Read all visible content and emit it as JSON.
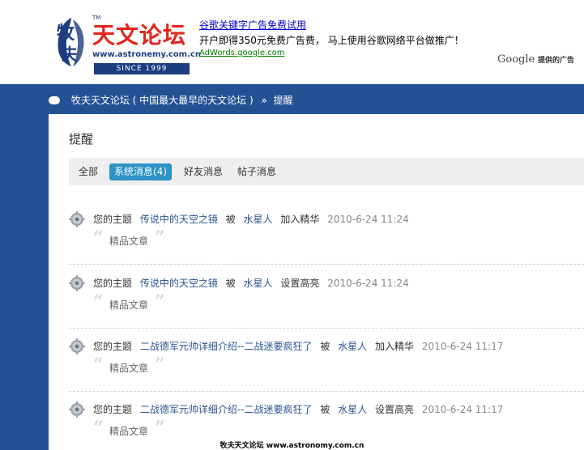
{
  "header": {
    "logo": {
      "brand_text": "天文论坛",
      "brand_prefix": "牧夫",
      "sup": "TM",
      "url_text": "www.astronemy.com.cn",
      "since_text": "SINCE 1999"
    },
    "ad": {
      "title": "谷歌关键字广告免费试用",
      "text": "开户即得350元免费广告费， 马上使用谷歌网络平台做推广！",
      "url": "AdWords.google.com"
    },
    "google_badge": {
      "google": "Google",
      "suffix": "提供的广告"
    }
  },
  "breadcrumb": {
    "site": "牧夫天文论坛 ( 中国最大最早的天文论坛 )",
    "separator": "»",
    "current": "提醒"
  },
  "page": {
    "title": "提醒",
    "tabs": [
      {
        "label": "全部",
        "active": false
      },
      {
        "label": "系统消息(4)",
        "active": true
      },
      {
        "label": "好友消息",
        "active": false
      },
      {
        "label": "帖子消息",
        "active": false
      }
    ],
    "notifications": [
      {
        "prefix": "您的主题",
        "topic": "传说中的天空之镜",
        "by": "被",
        "user": "水星人",
        "action": "加入精华",
        "time": "2010-6-24 11:24",
        "quote": "精品文章"
      },
      {
        "prefix": "您的主题",
        "topic": "传说中的天空之镜",
        "by": "被",
        "user": "水星人",
        "action": "设置高亮",
        "time": "2010-6-24 11:24",
        "quote": "精品文章"
      },
      {
        "prefix": "您的主题",
        "topic": "二战德军元帅详细介绍--二战迷要疯狂了",
        "by": "被",
        "user": "水星人",
        "action": "加入精华",
        "time": "2010-6-24 11:17",
        "quote": "精品文章"
      },
      {
        "prefix": "您的主题",
        "topic": "二战德军元帅详细介绍--二战迷要疯狂了",
        "by": "被",
        "user": "水星人",
        "action": "设置高亮",
        "time": "2010-6-24 11:17",
        "quote": "精品文章"
      }
    ]
  },
  "footer": {
    "text": "牧夫天文论坛 www.astronomy.com.cn"
  },
  "colors": {
    "nav_bg": "#245195",
    "tab_active": "#2b93c5",
    "link": "#2a5593",
    "brand_red": "#e0261c"
  },
  "icons": {
    "notification": "gear-icon",
    "breadcrumb": "speech-bubble-icon",
    "quote_open": "open-quote-icon",
    "quote_close": "close-quote-icon"
  }
}
